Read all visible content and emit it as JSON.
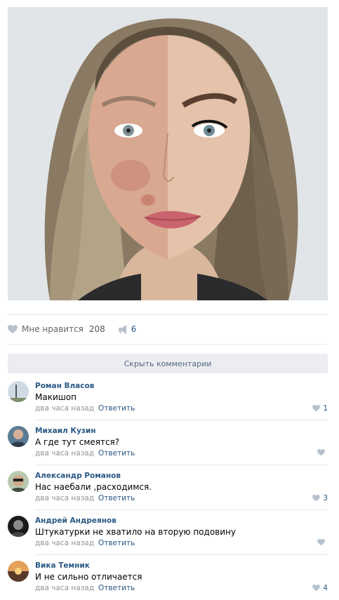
{
  "post": {
    "photo_icon": "face-makeup-comparison-photo",
    "likes_label": "Мне нравится",
    "likes_count": "208",
    "shares_count": "6"
  },
  "comments_toggle_label": "Скрыть комментарии",
  "comments": [
    {
      "author": "Роман Власов",
      "text": "Макишоп",
      "time": "два часа назад",
      "reply_label": "Ответить",
      "likes": "1"
    },
    {
      "author": "Михаил Кузин",
      "text": "А где тут смеятся?",
      "time": "два часа назад",
      "reply_label": "Ответить",
      "likes": ""
    },
    {
      "author": "Александр Романов",
      "text": "Нас наебали ,расходимся.",
      "time": "два часа назад",
      "reply_label": "Ответить",
      "likes": "3"
    },
    {
      "author": "Андрей Андреянов",
      "text": "Штукатурки не хватило на вторую подовину",
      "time": "два часа назад",
      "reply_label": "Ответить",
      "likes": ""
    },
    {
      "author": "Вика Темник",
      "text": "И не сильно отличается",
      "time": "два часа назад",
      "reply_label": "Ответить",
      "likes": "4"
    }
  ],
  "colors": {
    "link": "#2a5885",
    "meta": "#939393",
    "divider": "#e7e8ec",
    "button_bg": "#ebedf1"
  }
}
